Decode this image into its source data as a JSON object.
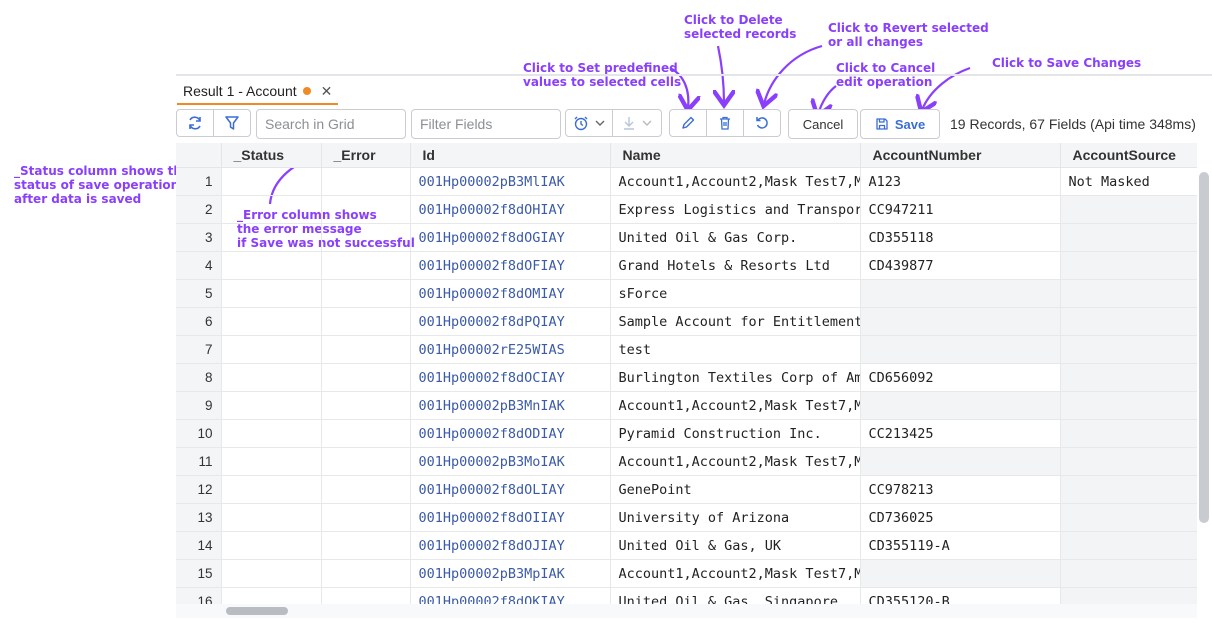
{
  "tab": {
    "title": "Result 1 - Account"
  },
  "toolbar": {
    "search_placeholder": "Search in Grid",
    "filter_placeholder": "Filter Fields",
    "cancel_label": "Cancel",
    "save_label": "Save",
    "records_info": "19 Records, 67 Fields (Api time 348ms)"
  },
  "annotations": {
    "status_col": "_Status column shows the\nstatus of save operation\nafter data is saved",
    "error_col": "_Error column shows\nthe error message\nif Save was not successful",
    "set_values": "Click to Set predefined\nvalues to selected cells",
    "delete": "Click to Delete\nselected records",
    "revert": "Click to Revert selected\nor all changes",
    "cancel": "Click to Cancel\nedit operation",
    "save": "Click to Save Changes"
  },
  "columns": [
    "",
    "_Status",
    "_Error",
    "Id",
    "Name",
    "AccountNumber",
    "AccountSource"
  ],
  "rows": [
    {
      "n": "1",
      "id": "001Hp00002pB3MlIAK",
      "name": "Account1,Account2,Mask Test7,M",
      "num": "A123",
      "src": "Not Masked"
    },
    {
      "n": "2",
      "id": "001Hp00002f8dOHIAY",
      "name": "Express Logistics and Transpor",
      "num": "CC947211",
      "src": ""
    },
    {
      "n": "3",
      "id": "001Hp00002f8dOGIAY",
      "name": "United Oil & Gas Corp.",
      "num": "CD355118",
      "src": ""
    },
    {
      "n": "4",
      "id": "001Hp00002f8dOFIAY",
      "name": "Grand Hotels & Resorts Ltd",
      "num": "CD439877",
      "src": ""
    },
    {
      "n": "5",
      "id": "001Hp00002f8dOMIAY",
      "name": "sForce",
      "num": "",
      "src": ""
    },
    {
      "n": "6",
      "id": "001Hp00002f8dPQIAY",
      "name": "Sample Account for Entitlement",
      "num": "",
      "src": ""
    },
    {
      "n": "7",
      "id": "001Hp00002rE25WIAS",
      "name": "test",
      "num": "",
      "src": ""
    },
    {
      "n": "8",
      "id": "001Hp00002f8dOCIAY",
      "name": "Burlington Textiles Corp of Am",
      "num": "CD656092",
      "src": ""
    },
    {
      "n": "9",
      "id": "001Hp00002pB3MnIAK",
      "name": "Account1,Account2,Mask Test7,M",
      "num": "",
      "src": ""
    },
    {
      "n": "10",
      "id": "001Hp00002f8dODIAY",
      "name": "Pyramid Construction Inc.",
      "num": "CC213425",
      "src": ""
    },
    {
      "n": "11",
      "id": "001Hp00002pB3MoIAK",
      "name": "Account1,Account2,Mask Test7,M",
      "num": "",
      "src": ""
    },
    {
      "n": "12",
      "id": "001Hp00002f8dOLIAY",
      "name": "GenePoint",
      "num": "CC978213",
      "src": ""
    },
    {
      "n": "13",
      "id": "001Hp00002f8dOIIAY",
      "name": "University of Arizona",
      "num": "CD736025",
      "src": ""
    },
    {
      "n": "14",
      "id": "001Hp00002f8dOJIAY",
      "name": "United Oil & Gas, UK",
      "num": "CD355119-A",
      "src": ""
    },
    {
      "n": "15",
      "id": "001Hp00002pB3MpIAK",
      "name": "Account1,Account2,Mask Test7,M",
      "num": "",
      "src": ""
    },
    {
      "n": "16",
      "id": "001Hp00002f8dOKIAY",
      "name": "United Oil & Gas, Singapore",
      "num": "CD355120-B",
      "src": ""
    }
  ]
}
